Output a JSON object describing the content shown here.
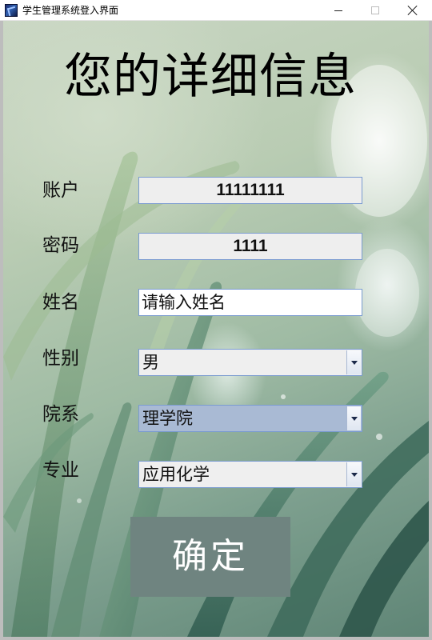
{
  "window": {
    "title": "学生管理系统登入界面",
    "controls": [
      "minimize",
      "maximize",
      "close"
    ]
  },
  "form": {
    "heading": "您的详细信息",
    "fields": {
      "account": {
        "label": "账户",
        "value": "11111111"
      },
      "password": {
        "label": "密码",
        "value": "1111"
      },
      "name": {
        "label": "姓名",
        "value": "请输入姓名"
      },
      "gender": {
        "label": "性别",
        "selected": "男"
      },
      "department": {
        "label": "院系",
        "selected": "理学院"
      },
      "major": {
        "label": "专业",
        "selected": "应用化学"
      }
    },
    "confirm_label": "确定"
  },
  "colors": {
    "field_border": "#7a9bd0",
    "readonly_field_bg": "#eeeeee",
    "selected_combo_bg": "#a9bad4",
    "confirm_button_bg": "#6f8480"
  }
}
